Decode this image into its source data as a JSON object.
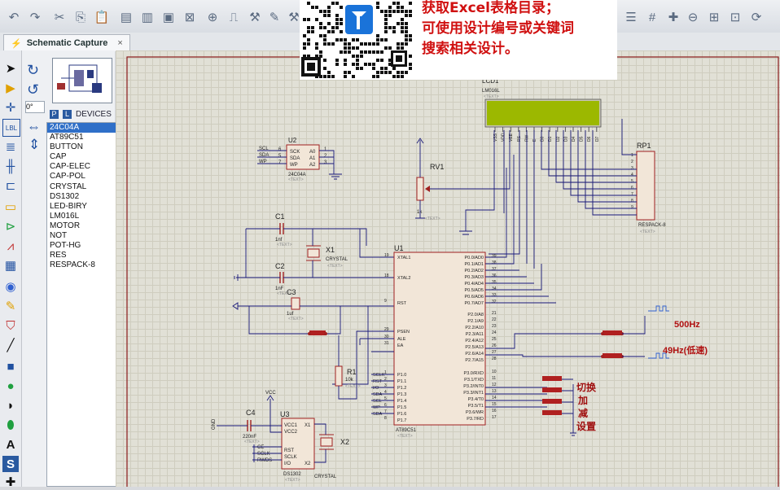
{
  "app": {
    "tab_label": "Schematic Capture",
    "tab_close": "×",
    "rotation_value": "0°"
  },
  "device_panel": {
    "p_button": "P",
    "l_button": "L",
    "header": "DEVICES",
    "items": [
      "24C04A",
      "AT89C51",
      "BUTTON",
      "CAP",
      "CAP-ELEC",
      "CAP-POL",
      "CRYSTAL",
      "DS1302",
      "LED-BIRY",
      "LM016L",
      "MOTOR",
      "NOT",
      "POT-HG",
      "RES",
      "RESPACK-8"
    ],
    "selected_index": 0
  },
  "overlay": {
    "line1": "获取Excel表格目录；",
    "line2": "可使用设计编号或关键词",
    "line3": "搜索相关设计。"
  },
  "schematic": {
    "lcd": {
      "ref": "LCD1",
      "part": "LM016L",
      "text": "<TEXT>",
      "pins": [
        "VSS",
        "VDD",
        "VEE",
        "RS",
        "RW",
        "E",
        "D0",
        "D1",
        "D2",
        "D3",
        "D4",
        "D5",
        "D6",
        "D7"
      ]
    },
    "u2": {
      "ref": "U2",
      "part": "24C04A",
      "text": "<TEXT>",
      "left_pins": [
        "SCK",
        "SDA",
        "WP"
      ],
      "right_pins": [
        "A0",
        "A1",
        "A2"
      ],
      "nets": [
        "SCL",
        "SDA",
        "WP"
      ],
      "pin_nums": [
        "6",
        "5",
        "7",
        "1",
        "2",
        "3"
      ]
    },
    "rv1": {
      "ref": "RV1",
      "value": "1k",
      "text": "<TEXT>"
    },
    "rp1": {
      "ref": "RP1",
      "part": "RESPACK-8",
      "text": "<TEXT>",
      "pins": [
        "1",
        "2",
        "3",
        "4",
        "5",
        "6",
        "7",
        "8",
        "9"
      ]
    },
    "c1": {
      "ref": "C1",
      "value": "1nf",
      "text": "<TEXT>"
    },
    "c2": {
      "ref": "C2",
      "value": "1nF",
      "text": "<TEXT>"
    },
    "c3": {
      "ref": "C3",
      "value": "1uf",
      "text": "<TEXT>"
    },
    "c4": {
      "ref": "C4",
      "value": "220nF",
      "text": "<TEXT>"
    },
    "x1": {
      "ref": "X1",
      "part": "CRYSTAL",
      "text": "<TEXT>"
    },
    "x2": {
      "ref": "X2",
      "part": "CRYSTAL"
    },
    "r1": {
      "ref": "R1",
      "value": "10k",
      "text": "<TEXT>"
    },
    "u1": {
      "ref": "U1",
      "part": "AT89C51",
      "text": "<TEXT>",
      "left_pins": [
        "XTAL1",
        "XTAL2",
        "RST",
        "PSEN",
        "ALE",
        "EA",
        "P1.0",
        "P1.1",
        "P1.2",
        "P1.3",
        "P1.4",
        "P1.5",
        "P1.6",
        "P1.7"
      ],
      "left_nums": [
        "19",
        "18",
        "9",
        "29",
        "30",
        "31",
        "1",
        "2",
        "3",
        "4",
        "5",
        "6",
        "7",
        "8"
      ],
      "right_pins": [
        "P0.0/AD0",
        "P0.1/AD1",
        "P0.2/AD2",
        "P0.3/AD3",
        "P0.4/AD4",
        "P0.5/AD5",
        "P0.6/AD6",
        "P0.7/AD7",
        "P2.0/A8",
        "P2.1/A9",
        "P2.2/A10",
        "P2.3/A11",
        "P2.4/A12",
        "P2.5/A13",
        "P2.6/A14",
        "P2.7/A15",
        "P3.0/RXD",
        "P3.1/TXD",
        "P3.2/INT0",
        "P3.3/INT1",
        "P3.4/T0",
        "P3.5/T1",
        "P3.6/WR",
        "P3.7/RD"
      ],
      "right_nums": [
        "39",
        "38",
        "37",
        "36",
        "35",
        "34",
        "33",
        "32",
        "21",
        "22",
        "23",
        "24",
        "25",
        "26",
        "27",
        "28",
        "10",
        "11",
        "12",
        "13",
        "14",
        "15",
        "16",
        "17"
      ],
      "net_labels": [
        "SCLK",
        "RST",
        "I/O",
        "SDA",
        "SCL",
        "WP",
        "SDA"
      ]
    },
    "u3": {
      "ref": "U3",
      "part": "DS1302",
      "text": "<TEXT>",
      "left_pins": [
        "VCC1",
        "VCC2",
        "RST",
        "SCLK",
        "I/O"
      ],
      "right_pins": [
        "X1",
        "X2"
      ],
      "nets": [
        "CE",
        "SCLK",
        "RWDS"
      ],
      "vcc": "VCC",
      "gnd": "GND"
    },
    "labels": {
      "freq1": "500Hz",
      "freq2": "49Hz(低速)",
      "switch": "切换",
      "add": "加",
      "sub": "减",
      "setting": "设置"
    }
  },
  "colors": {
    "wire": "#19197a",
    "component": "#b02020",
    "lcd_screen": "#9cb800",
    "annotation": "#d01010"
  }
}
